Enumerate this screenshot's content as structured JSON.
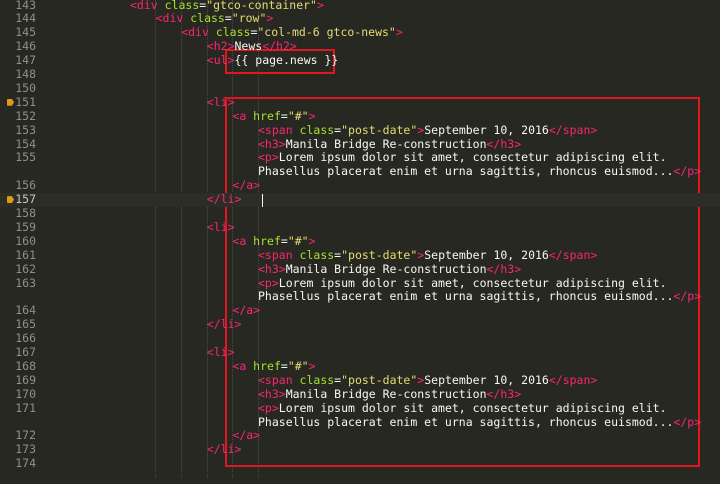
{
  "editor": {
    "lines": [
      {
        "num": "143",
        "indent": 0,
        "tokens": [
          [
            "tag",
            "<div "
          ],
          [
            "attr",
            "class"
          ],
          [
            "txt",
            "="
          ],
          [
            "str",
            "\"gtco-container\""
          ],
          [
            "tag",
            ">"
          ]
        ]
      },
      {
        "num": "144",
        "indent": 1,
        "tokens": [
          [
            "tag",
            "<div "
          ],
          [
            "attr",
            "class"
          ],
          [
            "txt",
            "="
          ],
          [
            "str",
            "\"row\""
          ],
          [
            "tag",
            ">"
          ]
        ]
      },
      {
        "num": "145",
        "indent": 2,
        "tokens": [
          [
            "tag",
            "<div "
          ],
          [
            "attr",
            "class"
          ],
          [
            "txt",
            "="
          ],
          [
            "str",
            "\"col-md-6 gtco-news\""
          ],
          [
            "tag",
            ">"
          ]
        ]
      },
      {
        "num": "146",
        "indent": 3,
        "tokens": [
          [
            "tag",
            "<h2>"
          ],
          [
            "txt",
            "News"
          ],
          [
            "tag",
            "</h2>"
          ]
        ]
      },
      {
        "num": "147",
        "indent": 3,
        "tokens": [
          [
            "tag",
            "<ul>"
          ],
          [
            "txt",
            "{{ page.news }}"
          ]
        ]
      },
      {
        "num": "148",
        "indent": 0,
        "tokens": []
      },
      {
        "num": "150",
        "indent": 0,
        "tokens": []
      },
      {
        "num": "151",
        "indent": 3,
        "bookmark": true,
        "tokens": [
          [
            "tag",
            "<li>"
          ]
        ]
      },
      {
        "num": "152",
        "indent": 4,
        "tokens": [
          [
            "tag",
            "<a "
          ],
          [
            "attr",
            "href"
          ],
          [
            "txt",
            "="
          ],
          [
            "str",
            "\"#\""
          ],
          [
            "tag",
            ">"
          ]
        ]
      },
      {
        "num": "153",
        "indent": 5,
        "tokens": [
          [
            "tag",
            "<span "
          ],
          [
            "attr",
            "class"
          ],
          [
            "txt",
            "="
          ],
          [
            "str",
            "\"post-date\""
          ],
          [
            "tag",
            ">"
          ],
          [
            "txt",
            "September 10, 2016"
          ],
          [
            "tag",
            "</span>"
          ]
        ]
      },
      {
        "num": "154",
        "indent": 5,
        "tokens": [
          [
            "tag",
            "<h3>"
          ],
          [
            "txt",
            "Manila Bridge Re-construction"
          ],
          [
            "tag",
            "</h3>"
          ]
        ]
      },
      {
        "num": "155",
        "indent": 5,
        "tokens": [
          [
            "tag",
            "<p>"
          ],
          [
            "txt",
            "Lorem ipsum dolor sit amet, consectetur adipiscing elit."
          ]
        ]
      },
      {
        "num": "",
        "indent": 5,
        "tokens": [
          [
            "txt",
            "Phasellus placerat enim et urna sagittis, rhoncus euismod..."
          ],
          [
            "tag",
            "</p>"
          ]
        ]
      },
      {
        "num": "156",
        "indent": 4,
        "tokens": [
          [
            "tag",
            "</a>"
          ]
        ]
      },
      {
        "num": "157",
        "indent": 3,
        "bookmark": true,
        "current": true,
        "tokens": [
          [
            "tag",
            "</li>"
          ]
        ]
      },
      {
        "num": "158",
        "indent": 0,
        "tokens": []
      },
      {
        "num": "159",
        "indent": 3,
        "tokens": [
          [
            "tag",
            "<li>"
          ]
        ]
      },
      {
        "num": "160",
        "indent": 4,
        "tokens": [
          [
            "tag",
            "<a "
          ],
          [
            "attr",
            "href"
          ],
          [
            "txt",
            "="
          ],
          [
            "str",
            "\"#\""
          ],
          [
            "tag",
            ">"
          ]
        ]
      },
      {
        "num": "161",
        "indent": 5,
        "tokens": [
          [
            "tag",
            "<span "
          ],
          [
            "attr",
            "class"
          ],
          [
            "txt",
            "="
          ],
          [
            "str",
            "\"post-date\""
          ],
          [
            "tag",
            ">"
          ],
          [
            "txt",
            "September 10, 2016"
          ],
          [
            "tag",
            "</span>"
          ]
        ]
      },
      {
        "num": "162",
        "indent": 5,
        "tokens": [
          [
            "tag",
            "<h3>"
          ],
          [
            "txt",
            "Manila Bridge Re-construction"
          ],
          [
            "tag",
            "</h3>"
          ]
        ]
      },
      {
        "num": "163",
        "indent": 5,
        "tokens": [
          [
            "tag",
            "<p>"
          ],
          [
            "txt",
            "Lorem ipsum dolor sit amet, consectetur adipiscing elit."
          ]
        ]
      },
      {
        "num": "",
        "indent": 5,
        "tokens": [
          [
            "txt",
            "Phasellus placerat enim et urna sagittis, rhoncus euismod..."
          ],
          [
            "tag",
            "</p>"
          ]
        ]
      },
      {
        "num": "164",
        "indent": 4,
        "tokens": [
          [
            "tag",
            "</a>"
          ]
        ]
      },
      {
        "num": "165",
        "indent": 3,
        "tokens": [
          [
            "tag",
            "</li>"
          ]
        ]
      },
      {
        "num": "166",
        "indent": 0,
        "tokens": []
      },
      {
        "num": "167",
        "indent": 3,
        "tokens": [
          [
            "tag",
            "<li>"
          ]
        ]
      },
      {
        "num": "168",
        "indent": 4,
        "tokens": [
          [
            "tag",
            "<a "
          ],
          [
            "attr",
            "href"
          ],
          [
            "txt",
            "="
          ],
          [
            "str",
            "\"#\""
          ],
          [
            "tag",
            ">"
          ]
        ]
      },
      {
        "num": "169",
        "indent": 5,
        "tokens": [
          [
            "tag",
            "<span "
          ],
          [
            "attr",
            "class"
          ],
          [
            "txt",
            "="
          ],
          [
            "str",
            "\"post-date\""
          ],
          [
            "tag",
            ">"
          ],
          [
            "txt",
            "September 10, 2016"
          ],
          [
            "tag",
            "</span>"
          ]
        ]
      },
      {
        "num": "170",
        "indent": 5,
        "tokens": [
          [
            "tag",
            "<h3>"
          ],
          [
            "txt",
            "Manila Bridge Re-construction"
          ],
          [
            "tag",
            "</h3>"
          ]
        ]
      },
      {
        "num": "171",
        "indent": 5,
        "tokens": [
          [
            "tag",
            "<p>"
          ],
          [
            "txt",
            "Lorem ipsum dolor sit amet, consectetur adipiscing elit."
          ]
        ]
      },
      {
        "num": "",
        "indent": 5,
        "tokens": [
          [
            "txt",
            "Phasellus placerat enim et urna sagittis, rhoncus euismod..."
          ],
          [
            "tag",
            "</p>"
          ]
        ]
      },
      {
        "num": "172",
        "indent": 4,
        "tokens": [
          [
            "tag",
            "</a>"
          ]
        ]
      },
      {
        "num": "173",
        "indent": 3,
        "tokens": [
          [
            "tag",
            "</li>"
          ]
        ]
      },
      {
        "num": "174",
        "indent": 0,
        "tokens": []
      }
    ]
  },
  "colors": {
    "background": "#272822",
    "tag": "#f92672",
    "attribute": "#a6e22e",
    "string": "#e6db74",
    "text": "#f8f8f2",
    "line_number": "#8f908a",
    "bookmark": "#e29a16",
    "highlight_box": "#e3161f"
  },
  "icons": {
    "bookmark": "bookmark-icon"
  }
}
